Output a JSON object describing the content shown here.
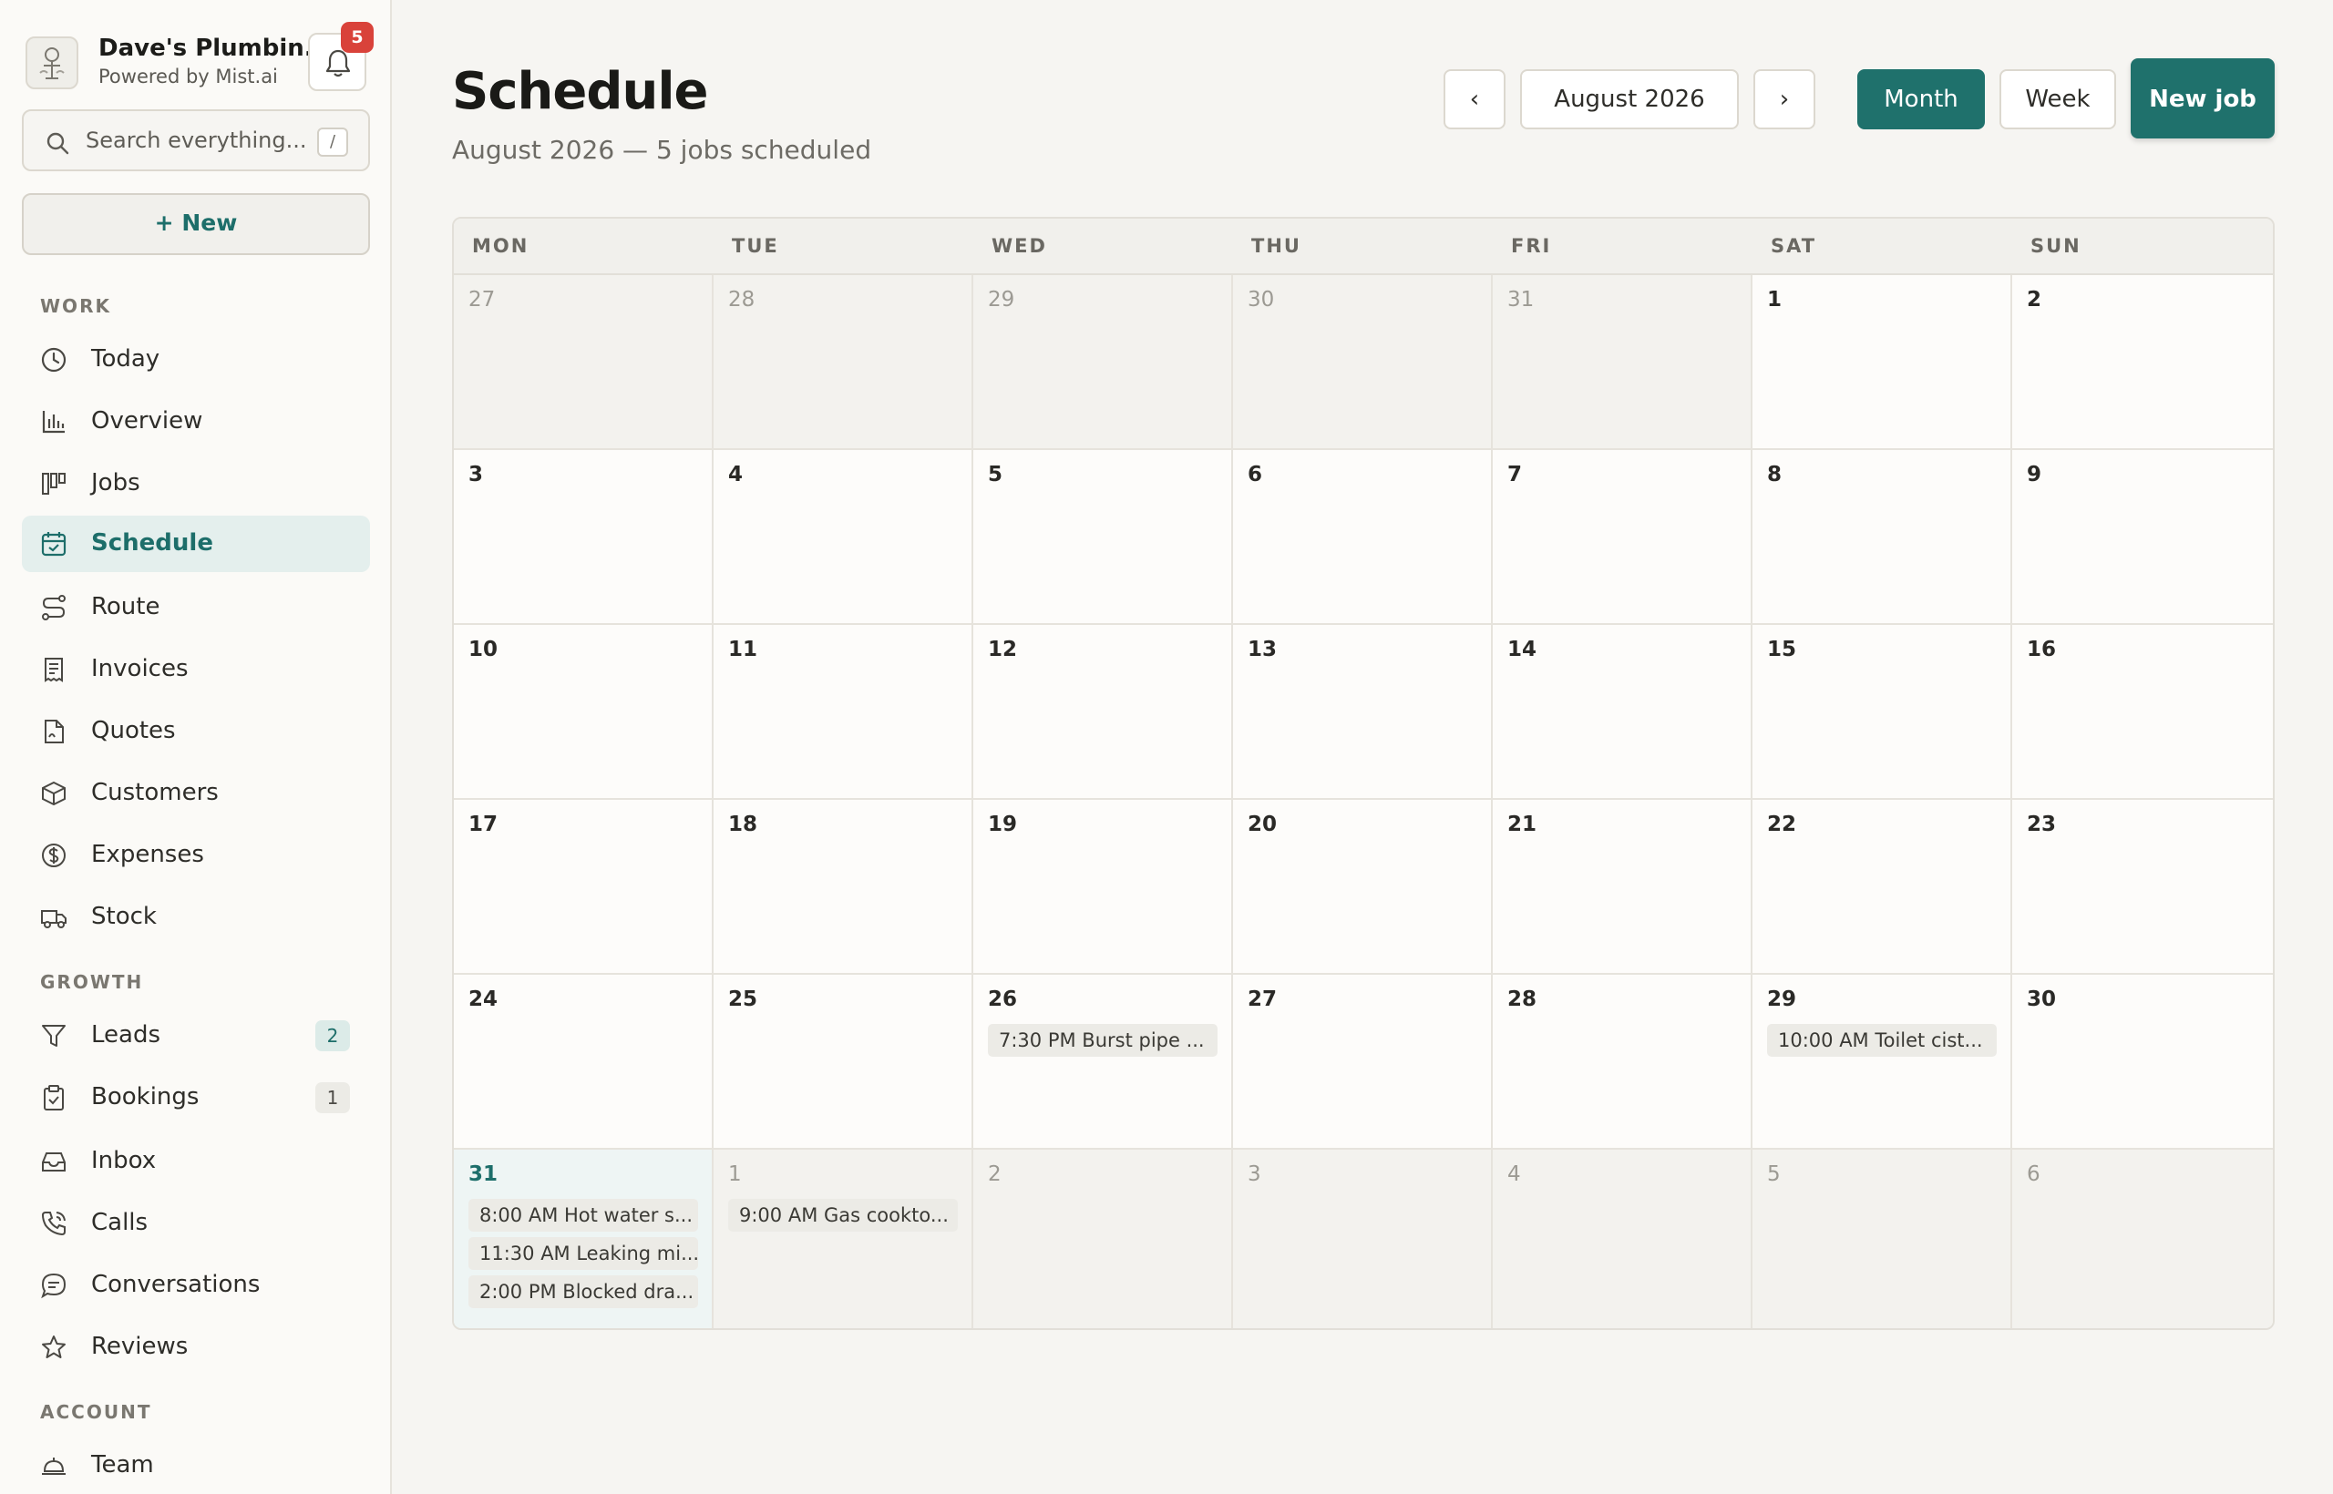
{
  "brand": {
    "name": "Dave's Plumbin...",
    "powered_by": "Powered by Mist.ai",
    "notification_count": "5"
  },
  "search": {
    "placeholder": "Search everything...",
    "shortcut": "/"
  },
  "new_button": {
    "label": "New"
  },
  "sidebar": {
    "sections": {
      "work": "WORK",
      "growth": "GROWTH",
      "account": "ACCOUNT"
    },
    "items": [
      {
        "label": "Today",
        "icon": "clock-icon"
      },
      {
        "label": "Overview",
        "icon": "bar-chart-icon"
      },
      {
        "label": "Jobs",
        "icon": "kanban-icon"
      },
      {
        "label": "Schedule",
        "icon": "calendar-icon",
        "active": true
      },
      {
        "label": "Route",
        "icon": "route-icon"
      },
      {
        "label": "Invoices",
        "icon": "receipt-icon"
      },
      {
        "label": "Quotes",
        "icon": "document-icon"
      },
      {
        "label": "Customers",
        "icon": "box-icon"
      },
      {
        "label": "Expenses",
        "icon": "dollar-icon"
      },
      {
        "label": "Stock",
        "icon": "truck-icon"
      },
      {
        "label": "Leads",
        "icon": "filter-icon",
        "count": "2"
      },
      {
        "label": "Bookings",
        "icon": "clipboard-check-icon",
        "count": "1"
      },
      {
        "label": "Inbox",
        "icon": "inbox-icon"
      },
      {
        "label": "Calls",
        "icon": "phone-icon"
      },
      {
        "label": "Conversations",
        "icon": "chat-icon"
      },
      {
        "label": "Reviews",
        "icon": "star-icon"
      },
      {
        "label": "Team",
        "icon": "bell-service-icon"
      }
    ]
  },
  "header": {
    "title": "Schedule",
    "subtitle": "August 2026 — 5 jobs scheduled",
    "prev": "‹",
    "current_month": "August 2026",
    "next": "›",
    "view_month": "Month",
    "view_week": "Week",
    "new_job": "New job"
  },
  "calendar": {
    "weekdays": [
      "MON",
      "TUE",
      "WED",
      "THU",
      "FRI",
      "SAT",
      "SUN"
    ],
    "weeks": [
      [
        "27",
        "28",
        "29",
        "30",
        "31",
        "1",
        "2"
      ],
      [
        "3",
        "4",
        "5",
        "6",
        "7",
        "8",
        "9"
      ],
      [
        "10",
        "11",
        "12",
        "13",
        "14",
        "15",
        "16"
      ],
      [
        "17",
        "18",
        "19",
        "20",
        "21",
        "22",
        "23"
      ],
      [
        "24",
        "25",
        "26",
        "27",
        "28",
        "29",
        "30"
      ],
      [
        "31",
        "1",
        "2",
        "3",
        "4",
        "5",
        "6"
      ]
    ],
    "events": {
      "aug26": [
        "7:30 PM Burst pipe ..."
      ],
      "aug29": [
        "10:00 AM Toilet cist..."
      ],
      "aug31": [
        "8:00 AM Hot water s...",
        "11:30 AM Leaking mi...",
        "2:00 PM Blocked dra..."
      ],
      "sep1": [
        "9:00 AM Gas cookto..."
      ]
    }
  },
  "colors": {
    "accent": "#1f716c",
    "badge": "#d9423a"
  }
}
